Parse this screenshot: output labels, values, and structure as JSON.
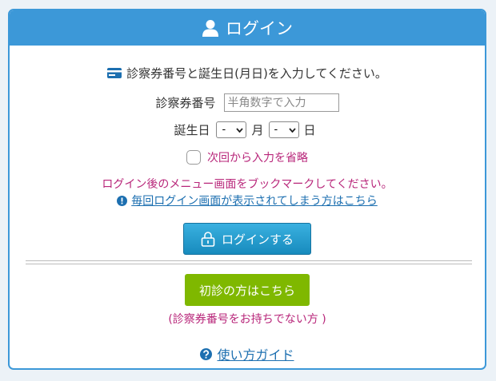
{
  "header": {
    "title": "ログイン",
    "icon": "user-icon"
  },
  "instruction": {
    "icon": "card-icon",
    "text": "診察券番号と誕生日(月日)を入力してください。"
  },
  "patient_id": {
    "label": "診察券番号",
    "value": "",
    "placeholder": "半角数字で入力"
  },
  "birthday": {
    "label": "誕生日",
    "month_value": "-",
    "month_label": "月",
    "day_value": "-",
    "day_label": "日"
  },
  "skip_checkbox": {
    "label": "次回から入力を省略",
    "checked": false
  },
  "notice": "ログイン後のメニュー画面をブックマークしてください。",
  "help_link": {
    "icon": "info-icon",
    "text": "毎回ログイン画面が表示されてしまう方はこちら"
  },
  "login_button": {
    "label": "ログインする",
    "icon": "lock-icon"
  },
  "first_visit_button": {
    "label": "初診の方はこちら"
  },
  "no_card_note": "(診察券番号をお持ちでない方 )",
  "guide_link": {
    "icon": "question-icon",
    "text": "使い方ガイド"
  },
  "colors": {
    "header": "#3c98d8",
    "login_button": "#1f9bcd",
    "first_visit_button": "#7fb800",
    "accent_text": "#b8267a",
    "link": "#1c6fb0"
  }
}
